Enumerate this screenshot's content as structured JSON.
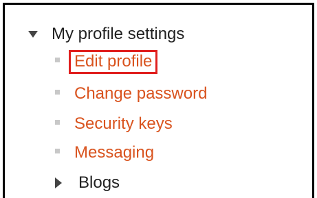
{
  "nav": {
    "section": {
      "label": "My profile settings",
      "icon": "triangle-down-icon"
    },
    "items": [
      {
        "label": "Edit profile",
        "highlighted": true
      },
      {
        "label": "Change password"
      },
      {
        "label": "Security keys"
      },
      {
        "label": "Messaging"
      }
    ],
    "blogs": {
      "label": "Blogs",
      "icon": "triangle-right-icon"
    }
  },
  "colors": {
    "link": "#d9531e",
    "highlight_border": "#e0201f",
    "text": "#222222",
    "bullet": "#c8c8c8",
    "frame_border": "#000000"
  }
}
